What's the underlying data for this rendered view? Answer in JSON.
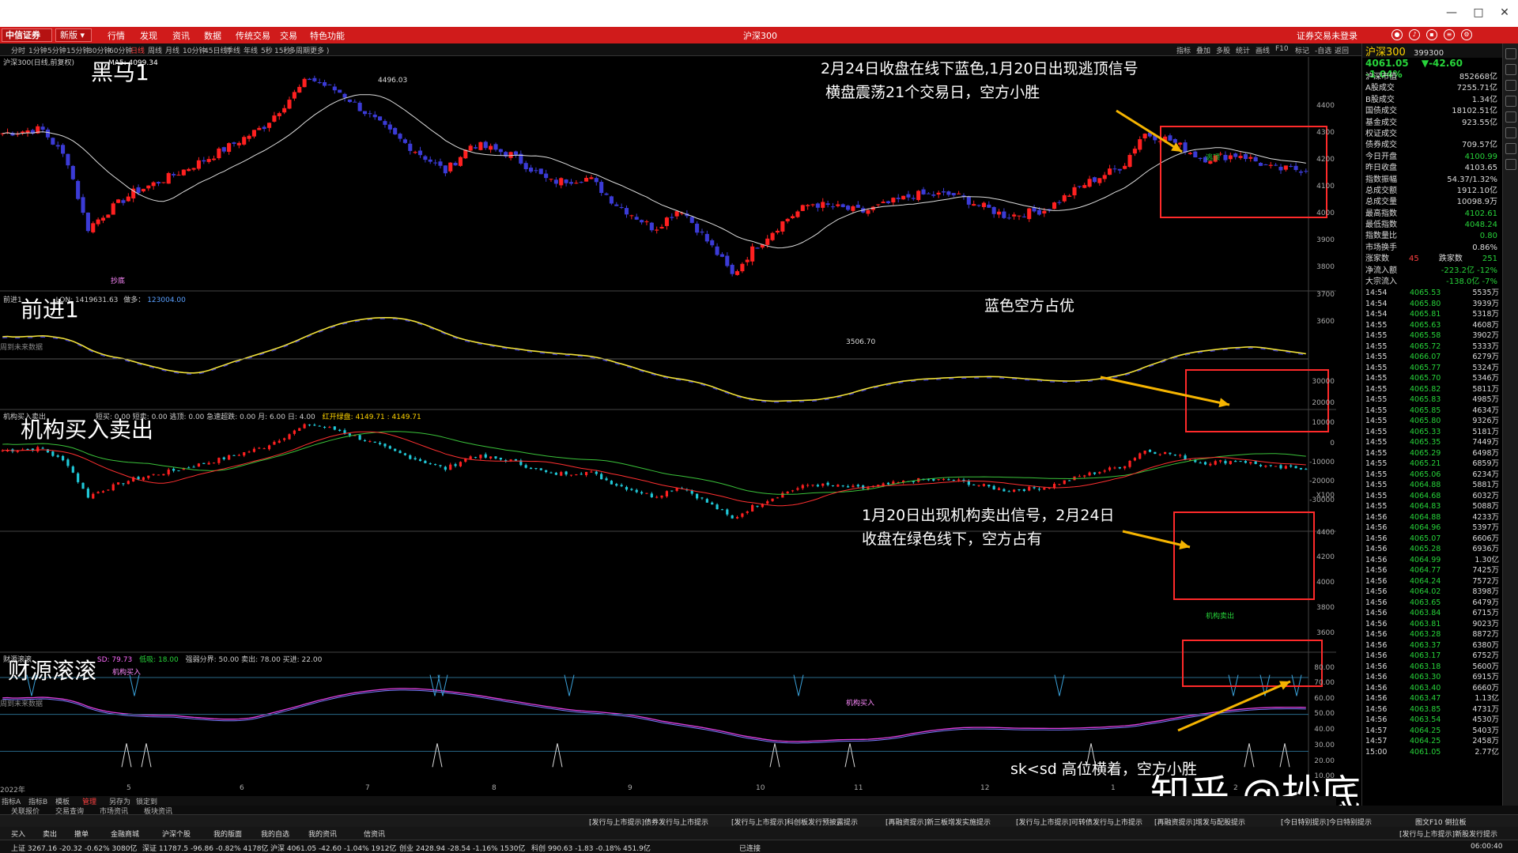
{
  "window": {
    "controls": [
      "—",
      "□",
      "✕"
    ]
  },
  "menubar": {
    "logo": "中信证券",
    "new_dropdown": "新版 ▾",
    "items": [
      "行情",
      "发现",
      "资讯",
      "数据",
      "传统交易",
      "交易",
      "特色功能"
    ],
    "center_title": "沪深300",
    "login_status": "证券交易未登录"
  },
  "periodbar": {
    "periods": [
      "分时",
      "1分钟",
      "5分钟",
      "15分钟",
      "30分钟",
      "60分钟",
      "日线",
      "周线",
      "月线",
      "10分钟",
      "45日线",
      "季线",
      "年线",
      "5秒",
      "15秒",
      "多周期",
      "更多 )"
    ],
    "active": "日线",
    "tools": [
      "指标",
      "叠加",
      "多股",
      "统计",
      "画线",
      "F10",
      "标记",
      "-自选",
      "返回"
    ]
  },
  "panels": {
    "main": {
      "header": "沪深300(日线,前复权)",
      "header_ma": "MA5: 4099.34",
      "title": "黑马1",
      "note_left": "周到未来数据",
      "annotation": [
        "2月24日收盘在线下蓝色,1月20日出现逃顶信号",
        "横盘震荡21个交易日，空方小胜"
      ],
      "markers": {
        "high": "4496.03",
        "low": "3506.70",
        "buy": "抄底",
        "escape": "逃顶",
        "top_tag": "逃顶"
      },
      "y_ticks": [
        "4400",
        "4300",
        "4200",
        "4100",
        "4000",
        "3900",
        "3800",
        "3700",
        "3600"
      ]
    },
    "second": {
      "header_a": "前进1",
      "header_b": "LON: 1419631.63",
      "header_c": "做多：",
      "header_d": "123004.00",
      "title": "前进1",
      "annotation": "蓝色空方占优",
      "y_ticks": [
        "30000",
        "20000",
        "10000",
        "0",
        "-10000",
        "-20000",
        "-30000"
      ],
      "x100": "X100"
    },
    "third": {
      "header_a": "机构买入卖出",
      "header_b": "短买: 0.00  短卖: 0.00  逃顶: 0.00  急速超跌: 0.00  月: 6.00  日: 4.00",
      "header_c": "红开绿盘: 4149.71 : 4149.71",
      "title": "机构买入卖出",
      "annotation": [
        "1月20日出现机构卖出信号，2月24日",
        "收盘在绿色线下，空方占有"
      ],
      "markers": {
        "buy1": "机构买入",
        "buy2": "机构买入",
        "sell": "机构卖出"
      },
      "note_left": "周到未来数据",
      "y_ticks": [
        "4400",
        "4200",
        "4000",
        "3800",
        "3600"
      ]
    },
    "fourth": {
      "header_a": "财源滚滚",
      "header_b": "SD: 79.73",
      "header_c": "低吸: 18.00",
      "header_d": "强弱分界: 50.00  卖出: 78.00  买进: 22.00",
      "title": "财源滚滚",
      "annotation": "sk<sd  高位横着，空方小胜",
      "y_ticks": [
        "80.00",
        "70.00",
        "60.00",
        "50.00",
        "40.00",
        "30.00",
        "20.00",
        "10.00"
      ]
    }
  },
  "x_axis": [
    "2022年",
    "5",
    "6",
    "7",
    "8",
    "9",
    "10",
    "11",
    "12",
    "1",
    "2"
  ],
  "side": {
    "name": "沪深300",
    "code": "399300",
    "price": "4061.05",
    "change": "▼-42.60",
    "pct": "-1.04%",
    "stats": [
      {
        "k": "沪深市值",
        "v": "852668亿",
        "c": ""
      },
      {
        "k": "A股成交",
        "v": "7255.71亿",
        "c": ""
      },
      {
        "k": "B股成交",
        "v": "1.34亿",
        "c": ""
      },
      {
        "k": "国债成交",
        "v": "18102.51亿",
        "c": ""
      },
      {
        "k": "基金成交",
        "v": "923.55亿",
        "c": ""
      },
      {
        "k": "权证成交",
        "v": "",
        "c": ""
      },
      {
        "k": "债券成交",
        "v": "709.57亿",
        "c": ""
      },
      {
        "k": "今日开盘",
        "v": "4100.99",
        "c": "green"
      },
      {
        "k": "昨日收盘",
        "v": "4103.65",
        "c": ""
      },
      {
        "k": "指数振幅",
        "v": "54.37/1.32%",
        "c": ""
      },
      {
        "k": "总成交额",
        "v": "1912.10亿",
        "c": ""
      },
      {
        "k": "总成交量",
        "v": "10098.9万",
        "c": ""
      },
      {
        "k": "最高指数",
        "v": "4102.61",
        "c": "green"
      },
      {
        "k": "最低指数",
        "v": "4048.24",
        "c": "green"
      },
      {
        "k": "指数量比",
        "v": "0.80",
        "c": "green"
      },
      {
        "k": "市场换手",
        "v": "0.86%",
        "c": ""
      }
    ],
    "updown": {
      "up_label": "涨家数",
      "up": "45",
      "down_label": "跌家数",
      "down": "251"
    },
    "flow": [
      {
        "k": "净流入额",
        "v": "-223.2亿  -12%"
      },
      {
        "k": "大宗流入",
        "v": "-138.0亿  -7%"
      }
    ],
    "ticks": [
      [
        "14:54",
        "4065.53",
        "5535万"
      ],
      [
        "14:54",
        "4065.80",
        "3939万"
      ],
      [
        "14:54",
        "4065.81",
        "5318万"
      ],
      [
        "14:55",
        "4065.63",
        "4608万"
      ],
      [
        "14:55",
        "4065.58",
        "3902万"
      ],
      [
        "14:55",
        "4065.72",
        "5333万"
      ],
      [
        "14:55",
        "4066.07",
        "6279万"
      ],
      [
        "14:55",
        "4065.77",
        "5324万"
      ],
      [
        "14:55",
        "4065.70",
        "5346万"
      ],
      [
        "14:55",
        "4065.82",
        "5811万"
      ],
      [
        "14:55",
        "4065.83",
        "4985万"
      ],
      [
        "14:55",
        "4065.85",
        "4634万"
      ],
      [
        "14:55",
        "4065.80",
        "9326万"
      ],
      [
        "14:55",
        "4065.33",
        "5181万"
      ],
      [
        "14:55",
        "4065.35",
        "7449万"
      ],
      [
        "14:55",
        "4065.29",
        "6498万"
      ],
      [
        "14:55",
        "4065.21",
        "6859万"
      ],
      [
        "14:55",
        "4065.06",
        "6234万"
      ],
      [
        "14:55",
        "4064.88",
        "5881万"
      ],
      [
        "14:55",
        "4064.68",
        "6032万"
      ],
      [
        "14:55",
        "4064.83",
        "5088万"
      ],
      [
        "14:56",
        "4064.88",
        "4233万"
      ],
      [
        "14:56",
        "4064.96",
        "5397万"
      ],
      [
        "14:56",
        "4065.07",
        "6606万"
      ],
      [
        "14:56",
        "4065.28",
        "6936万"
      ],
      [
        "14:56",
        "4064.99",
        "1.30亿"
      ],
      [
        "14:56",
        "4064.77",
        "7425万"
      ],
      [
        "14:56",
        "4064.24",
        "7572万"
      ],
      [
        "14:56",
        "4064.02",
        "8398万"
      ],
      [
        "14:56",
        "4063.65",
        "6479万"
      ],
      [
        "14:56",
        "4063.84",
        "6715万"
      ],
      [
        "14:56",
        "4063.81",
        "9023万"
      ],
      [
        "14:56",
        "4063.28",
        "8872万"
      ],
      [
        "14:56",
        "4063.37",
        "6380万"
      ],
      [
        "14:56",
        "4063.17",
        "6752万"
      ],
      [
        "14:56",
        "4063.18",
        "5600万"
      ],
      [
        "14:56",
        "4063.30",
        "6915万"
      ],
      [
        "14:56",
        "4063.40",
        "6660万"
      ],
      [
        "14:56",
        "4063.47",
        "1.13亿"
      ],
      [
        "14:56",
        "4063.85",
        "4731万"
      ],
      [
        "14:56",
        "4063.54",
        "4530万"
      ],
      [
        "14:57",
        "4064.25",
        "5403万"
      ],
      [
        "14:57",
        "4064.25",
        "2458万"
      ],
      [
        "15:00",
        "4061.05",
        "2.77亿"
      ]
    ]
  },
  "tabsbar": [
    "指标A",
    "指标B",
    "模板",
    "管理",
    "另存为",
    "锁定到"
  ],
  "quickbar": [
    "关联报价",
    "交易查询",
    "市场资讯",
    "板块资讯"
  ],
  "newsbar": {
    "items": [
      "[发行与上市提示]债券发行与上市提示",
      "[发行与上市提示]科创板发行预披露提示",
      "[再融资提示]新三板增发实施提示",
      "[发行与上市提示]可转债发行与上市提示",
      "[再融资提示]增发与配股提示",
      "[今日特别提示]今日特别提示"
    ],
    "right": "图文F10  倒拉板"
  },
  "actionbar": [
    "买入",
    "卖出",
    "撤单",
    "金融商城",
    "沪深个股",
    "我的版面",
    "我的自选",
    "我的资讯",
    "信资讯",
    "[发行与上市提示]新股发行提示"
  ],
  "statusbar": [
    "上证 3267.16  -20.32  -0.62%  3080亿",
    "深证 11787.5  -96.86  -0.82%  4178亿",
    "沪深 4061.05  -42.60  -1.04%  1912亿",
    "创业 2428.94  -28.54  -1.16%  1530亿",
    "科创 990.63  -1.83  -0.18%  451.9亿",
    "已连接",
    "06:00:40"
  ],
  "watermark": "知乎 @抄底逃顶",
  "colors": {
    "up": "#ff2020",
    "down": "#3b3bd6",
    "accent": "#d01b1b",
    "box": "#ff2a2a",
    "arrow": "#f5b400"
  }
}
